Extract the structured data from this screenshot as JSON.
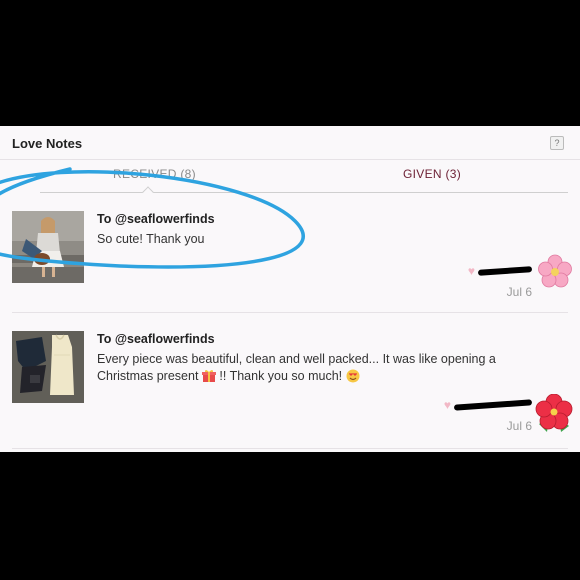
{
  "panel": {
    "title": "Love Notes",
    "help_icon": "?"
  },
  "tabs": [
    {
      "label": "RECEIVED (8)",
      "active": true
    },
    {
      "label": "GIVEN (3)",
      "active": false
    }
  ],
  "notes": [
    {
      "to": "To @seaflowerfinds",
      "message": "So cute! Thank you",
      "sender_redacted": true,
      "date": "Jul 6",
      "decoration": "cherry-blossom-icon"
    },
    {
      "to": "To @seaflowerfinds",
      "message_part1": "Every piece was beautiful, clean and well packed... It was like opening a Christmas present ",
      "message_part2": " !! Thank you so much! ",
      "sender_redacted": true,
      "date": "Jul 6",
      "decoration": "hibiscus-icon"
    }
  ],
  "colors": {
    "accent_tab": "#6e2236",
    "annotation_circle": "#2ea3e0",
    "heart": "#f2b8c6"
  }
}
